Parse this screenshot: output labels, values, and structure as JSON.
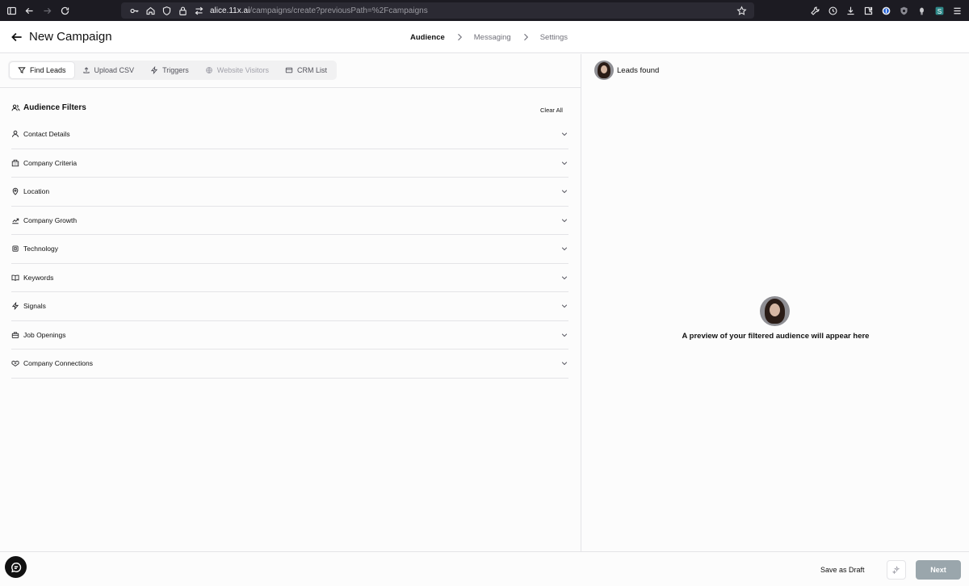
{
  "browser": {
    "url_domain": "alice.11x.ai",
    "url_path": "/campaigns/create?previousPath=%2Fcampaigns"
  },
  "header": {
    "title": "New Campaign",
    "steps": [
      "Audience",
      "Messaging",
      "Settings"
    ],
    "active_step": "Audience"
  },
  "source_tabs": [
    {
      "label": "Find Leads",
      "icon": "filter-icon",
      "state": "active"
    },
    {
      "label": "Upload CSV",
      "icon": "upload-icon",
      "state": "normal"
    },
    {
      "label": "Triggers",
      "icon": "zap-icon",
      "state": "normal"
    },
    {
      "label": "Website Visitors",
      "icon": "globe-icon",
      "state": "disabled"
    },
    {
      "label": "CRM List",
      "icon": "card-icon",
      "state": "normal"
    }
  ],
  "filters": {
    "title": "Audience Filters",
    "clear_label": "Clear All",
    "items": [
      {
        "label": "Contact Details",
        "icon": "user-icon"
      },
      {
        "label": "Company Criteria",
        "icon": "building-icon"
      },
      {
        "label": "Location",
        "icon": "map-pin-icon"
      },
      {
        "label": "Company Growth",
        "icon": "chart-icon"
      },
      {
        "label": "Technology",
        "icon": "cpu-icon"
      },
      {
        "label": "Keywords",
        "icon": "book-icon"
      },
      {
        "label": "Signals",
        "icon": "zap-icon"
      },
      {
        "label": "Job Openings",
        "icon": "briefcase-icon"
      },
      {
        "label": "Company Connections",
        "icon": "handshake-icon"
      }
    ]
  },
  "preview": {
    "leads_label": "Leads found",
    "empty_text": "A preview of your filtered audience will appear here"
  },
  "footer": {
    "save_draft_label": "Save as Draft",
    "next_label": "Next"
  },
  "colors": {
    "accent_disabled": "#9aa6ac",
    "border": "#e4e4e7",
    "chrome": "#1c1b22"
  }
}
